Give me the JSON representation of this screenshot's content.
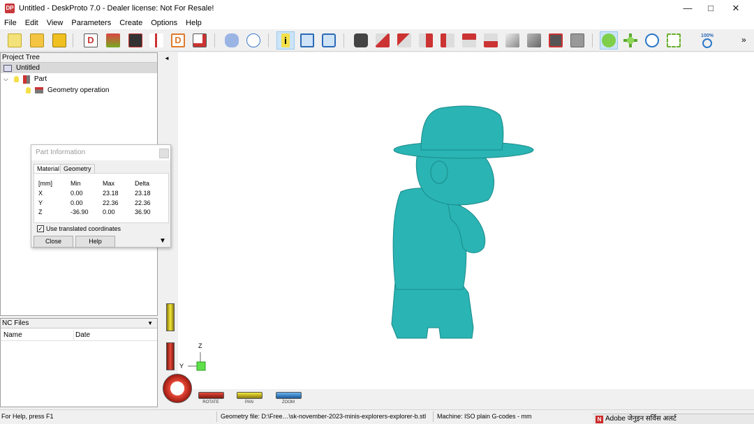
{
  "window": {
    "title": "Untitled - DeskProto 7.0 - Dealer license: Not For Resale!",
    "app_icon": "DP"
  },
  "menu": [
    "File",
    "Edit",
    "View",
    "Parameters",
    "Create",
    "Options",
    "Help"
  ],
  "toolbar": {
    "icons": [
      "new-project-icon",
      "open-project-icon",
      "save-project-icon",
      "part-wizard-icon",
      "add-part-icon",
      "bitmap-icon",
      "tool-icon",
      "drawing-icon",
      "export-icon",
      "layer-icon",
      "preview-icon",
      "info-icon",
      "window-icon",
      "view-icon",
      "camera-icon",
      "view-front-icon",
      "view-back-icon",
      "view-left-icon",
      "view-right-icon",
      "view-top-icon",
      "view-bottom-icon",
      "view-iso-icon",
      "view-iso2-icon",
      "render-icon",
      "render-wire-icon",
      "rotate-icon",
      "pan-icon",
      "zoom-in-icon",
      "zoom-window-icon",
      "zoom-100-icon"
    ],
    "zoom_label": "100%"
  },
  "project_tree": {
    "header": "Project Tree",
    "root": "Untitled",
    "part": "Part",
    "operation": "Geometry operation"
  },
  "nc_files": {
    "header": "NC Files",
    "columns": [
      "Name",
      "Date"
    ]
  },
  "dialog": {
    "title": "Part Information",
    "tabs": [
      "Material",
      "Geometry"
    ],
    "header": [
      "[mm]",
      "Min",
      "Max",
      "Delta"
    ],
    "rows": [
      [
        "X",
        "0.00",
        "23.18",
        "23.18"
      ],
      [
        "Y",
        "0.00",
        "22.36",
        "22.36"
      ],
      [
        "Z",
        "-36.90",
        "0.00",
        "36.90"
      ]
    ],
    "checkbox_label": "Use translated coordinates",
    "checkbox_checked": true,
    "close_label": "Close",
    "help_label": "Help"
  },
  "viewport": {
    "model_color": "#2ab4b4",
    "axis_z": "Z",
    "axis_y": "Y",
    "nav": [
      "ROTATE",
      "PAN",
      "ZOOM"
    ]
  },
  "status": {
    "help": "For Help, press F1",
    "geometry": "Geometry file: D:\\Free…\\sk-november-2023-minis-explorers-explorer-b.stl",
    "machine": "Machine: ISO plain G-codes - mm",
    "alert": "Adobe जेनुइन सर्विस अलर्ट"
  }
}
